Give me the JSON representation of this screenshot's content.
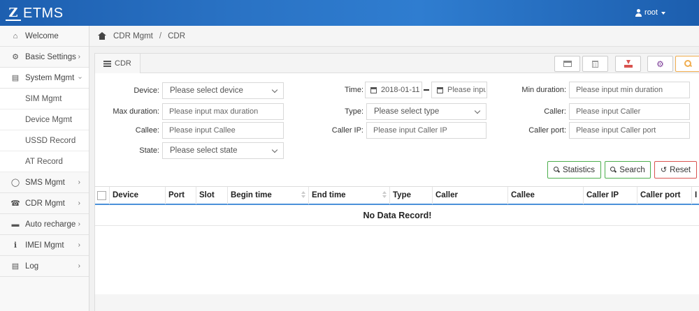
{
  "header": {
    "app_name": "ETMS",
    "logo_mark": "Z",
    "user": "root"
  },
  "sidebar": {
    "items": [
      {
        "label": "Welcome",
        "icon": "home-icon"
      },
      {
        "label": "Basic Settings",
        "icon": "gear-icon"
      },
      {
        "label": "System Mgmt",
        "icon": "inbox-icon",
        "expanded": true,
        "children": [
          "SIM Mgmt",
          "Device Mgmt",
          "USSD Record",
          "AT Record"
        ]
      },
      {
        "label": "SMS Mgmt",
        "icon": "comment-icon"
      },
      {
        "label": "CDR Mgmt",
        "icon": "phone-icon"
      },
      {
        "label": "Auto recharge",
        "icon": "credit-card-icon"
      },
      {
        "label": "IMEI Mgmt",
        "icon": "info-icon"
      },
      {
        "label": "Log",
        "icon": "inbox-icon"
      }
    ]
  },
  "breadcrumb": {
    "parent": "CDR Mgmt",
    "current": "CDR"
  },
  "tab": {
    "label": "CDR"
  },
  "form": {
    "device_label": "Device:",
    "device_placeholder": "Please select device",
    "time_label": "Time:",
    "time_start": "2018-01-11",
    "time_end_placeholder": "Please input",
    "min_duration_label": "Min duration:",
    "min_duration_placeholder": "Please input min duration",
    "max_duration_label": "Max duration:",
    "max_duration_placeholder": "Please input max duration",
    "type_label": "Type:",
    "type_placeholder": "Please select type",
    "caller_label": "Caller:",
    "caller_placeholder": "Please input Caller",
    "callee_label": "Callee:",
    "callee_placeholder": "Please input Callee",
    "caller_ip_label": "Caller IP:",
    "caller_ip_placeholder": "Please input Caller IP",
    "caller_port_label": "Caller port:",
    "caller_port_placeholder": "Please input Caller port",
    "state_label": "State:",
    "state_placeholder": "Please select state"
  },
  "actions": {
    "statistics": "Statistics",
    "search": "Search",
    "reset": "Reset"
  },
  "table": {
    "columns": [
      "Device",
      "Port",
      "Slot",
      "Begin time",
      "End time",
      "Type",
      "Caller",
      "Callee",
      "Caller IP",
      "Caller port",
      "I"
    ],
    "empty_message": "No Data Record!"
  },
  "colors": {
    "header_blue": "#2a73c5",
    "accent_blue": "#4a90d9",
    "success": "#4cae4c",
    "danger": "#d9534f",
    "warning": "#f0ad4e",
    "purple": "#7b3a96"
  }
}
